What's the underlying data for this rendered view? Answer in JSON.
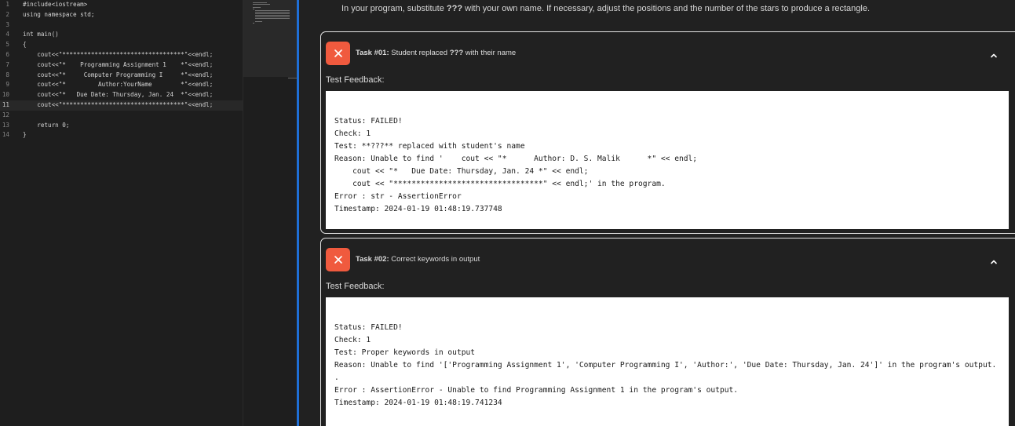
{
  "editor": {
    "current_line": 11,
    "lines": [
      {
        "n": "1",
        "code": "#include<iostream>"
      },
      {
        "n": "2",
        "code": "using namespace std;"
      },
      {
        "n": "3",
        "code": ""
      },
      {
        "n": "4",
        "code": "int main()"
      },
      {
        "n": "5",
        "code": "{"
      },
      {
        "n": "6",
        "code": "    cout<<\"**********************************\"<<endl;"
      },
      {
        "n": "7",
        "code": "    cout<<\"*    Programming Assignment 1    *\"<<endl;"
      },
      {
        "n": "8",
        "code": "    cout<<\"*     Computer Programming I     *\"<<endl;"
      },
      {
        "n": "9",
        "code": "    cout<<\"*         Author:YourName        *\"<<endl;"
      },
      {
        "n": "10",
        "code": "    cout<<\"*   Due Date: Thursday, Jan. 24  *\"<<endl;"
      },
      {
        "n": "11",
        "code": "    cout<<\"**********************************\"<<endl;"
      },
      {
        "n": "12",
        "code": ""
      },
      {
        "n": "13",
        "code": "    return 0;"
      },
      {
        "n": "14",
        "code": "}"
      }
    ]
  },
  "panel": {
    "instructions": {
      "before": "In your program, substitute ",
      "marker": "???",
      "after": " with your own name. If necessary, adjust the positions and the number of the stars to produce a rectangle."
    },
    "tasks": [
      {
        "status": "failed",
        "number": "Task #01:",
        "title_before": " Student replaced ",
        "title_marker": "???",
        "title_after": " with their name",
        "feedback_label": "Test Feedback:",
        "feedback": "Status: FAILED!\nCheck: 1\nTest: **???** replaced with student's name\nReason: Unable to find '    cout << \"*      Author: D. S. Malik      *\" << endl;\n    cout << \"*   Due Date: Thursday, Jan. 24 *\" << endl;\n    cout << \"*********************************\" << endl;' in the program.\nError : str - AssertionError\nTimestamp: 2024-01-19 01:48:19.737748"
      },
      {
        "status": "failed",
        "number": "Task #02:",
        "title_before": " Correct keywords in output",
        "title_marker": "",
        "title_after": "",
        "feedback_label": "Test Feedback:",
        "feedback": "Status: FAILED!\nCheck: 1\nTest: Proper keywords in output\nReason: Unable to find '['Programming Assignment 1', 'Computer Programming I', 'Author:', 'Due Date: Thursday, Jan. 24']' in the program's output.\n.\nError : AssertionError - Unable to find Programming Assignment 1 in the program's output.\nTimestamp: 2024-01-19 01:48:19.741234"
      }
    ]
  },
  "colors": {
    "accent_divider": "#1f6fd6",
    "failed_status": "#f05a3e",
    "panel_background": "#212121",
    "editor_background": "#1e1e1e"
  },
  "icons": {
    "status": "close-icon",
    "collapse": "chevron-up-icon"
  }
}
